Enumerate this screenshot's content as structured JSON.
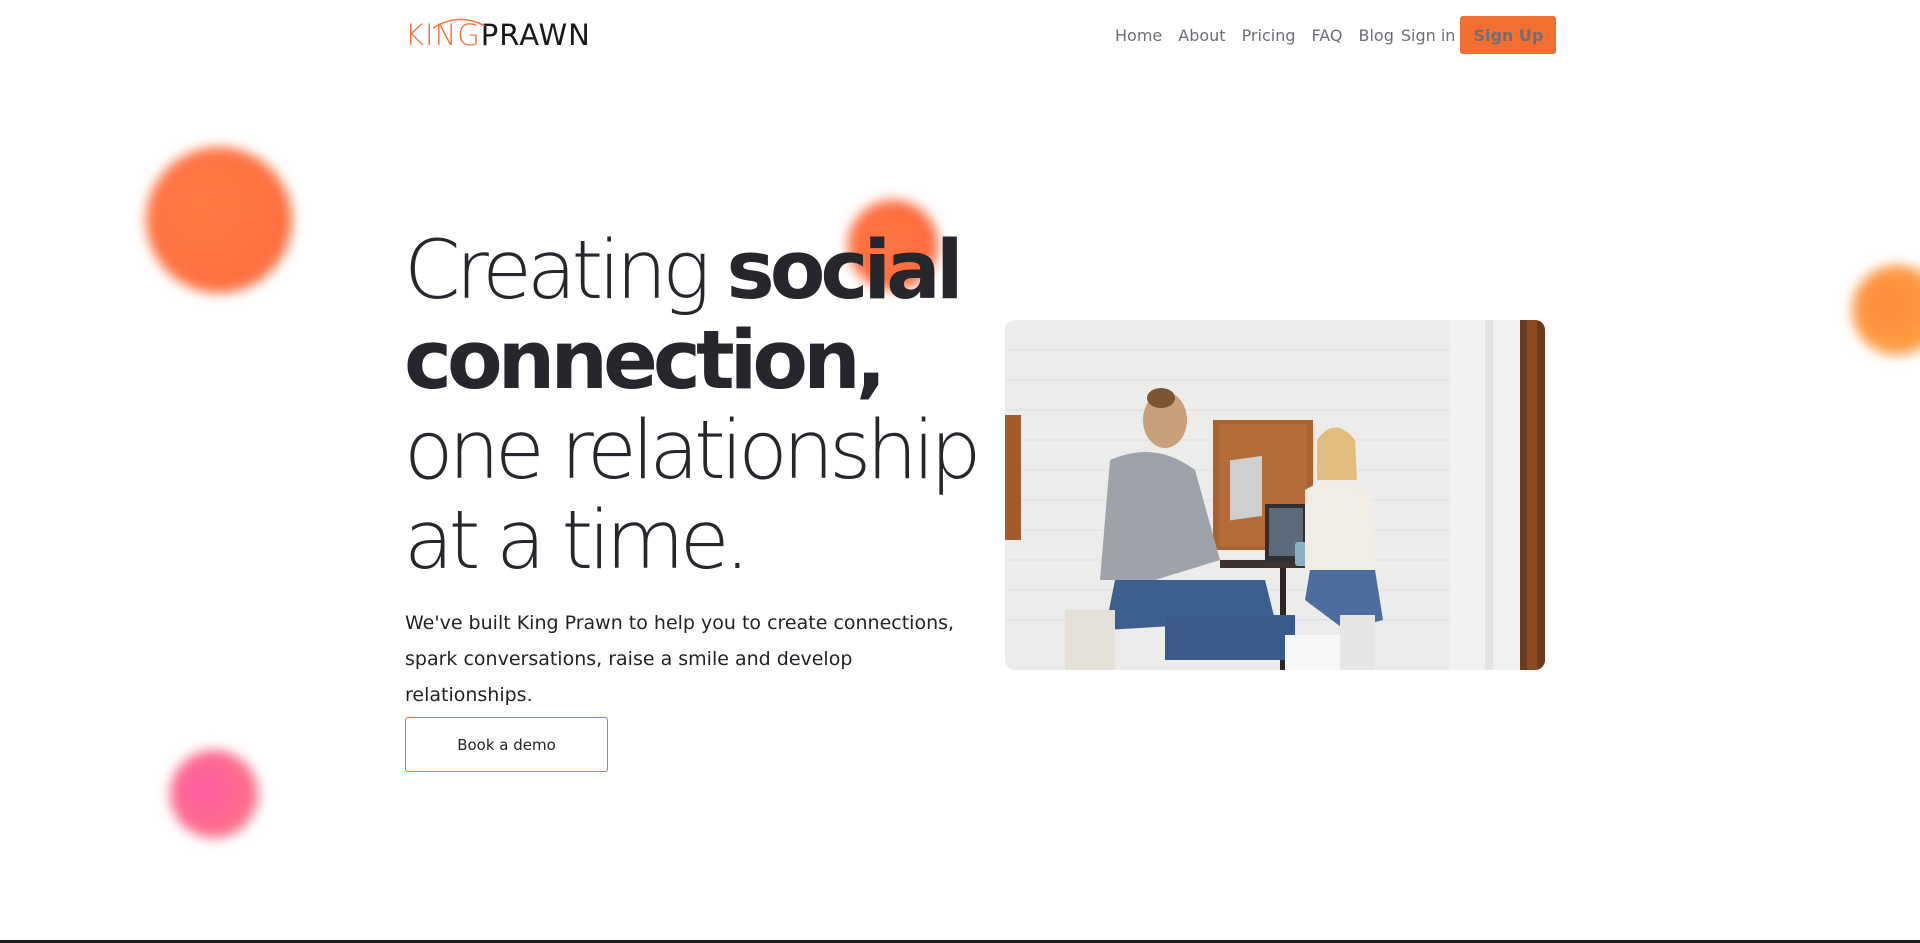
{
  "brand": {
    "logo_part1": "KING",
    "logo_part2": "PRAWN",
    "accent_color": "#f26f31"
  },
  "nav": {
    "items": [
      {
        "label": "Home"
      },
      {
        "label": "About"
      },
      {
        "label": "Pricing"
      },
      {
        "label": "FAQ"
      },
      {
        "label": "Blog"
      }
    ],
    "sign_in": "Sign in",
    "sign_up": "Sign Up"
  },
  "hero": {
    "title_light_1": "Creating ",
    "title_bold_1": "social",
    "title_bold_2": "connection,",
    "title_light_2": "one relationship",
    "title_light_3": "at a time.",
    "subtitle": "We've built King Prawn to help you to create connections, spark conversations, raise a smile and develop relationships.",
    "cta_label": "Book a demo"
  }
}
